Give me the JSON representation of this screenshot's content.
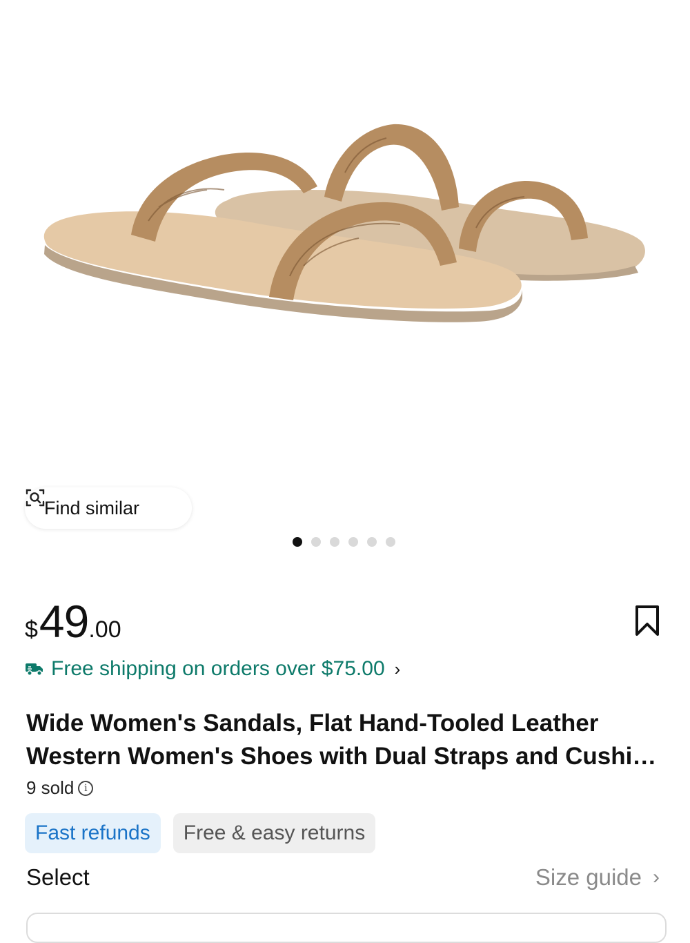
{
  "gallery": {
    "find_similar_label": "Find similar",
    "dot_count": 6,
    "active_dot": 0
  },
  "price": {
    "currency": "$",
    "integer": "49",
    "decimal": ".00"
  },
  "shipping": {
    "text": "Free shipping on orders over $75.00",
    "color": "#0d7a6a"
  },
  "product": {
    "title": "Wide Women's Sandals, Flat Hand-Tooled Leather Western Women's Shoes with Dual Straps and Cushi…",
    "sold": "9 sold"
  },
  "tags": [
    "Fast refunds",
    "Free & easy returns"
  ],
  "select": {
    "label": "Select",
    "size_guide": "Size guide"
  },
  "icons": {
    "find_similar": "image-search-icon",
    "shipping": "truck-icon",
    "bookmark": "bookmark-icon",
    "info": "info-icon",
    "chevron": "chevron-right-icon"
  }
}
